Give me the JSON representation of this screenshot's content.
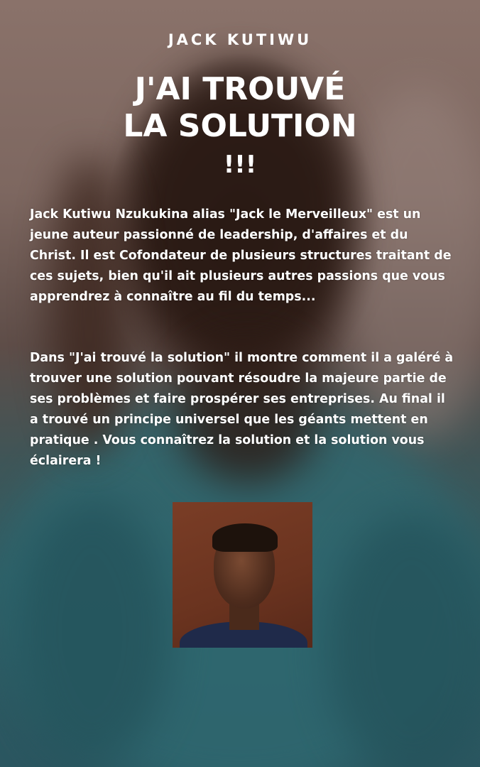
{
  "cover": {
    "author": "JACK KUTIWU",
    "title_line1": "J'AI TROUVÉ",
    "title_line2": "LA SOLUTION",
    "title_line3": "!!!",
    "paragraph1": "Jack Kutiwu Nzukukina alias \"Jack le Merveilleux\" est un jeune auteur passionné de leadership, d'affaires et du Christ. Il est Cofondateur de plusieurs structures traitant de ces sujets, bien qu'il ait plusieurs autres passions que vous apprendrez à connaître au fil du temps...",
    "paragraph2": "Dans \"J'ai trouvé la solution\" il montre comment il a galéré à trouver une solution pouvant résoudre la majeure partie de ses problèmes et faire prospérer ses entreprises. Au final il a trouvé un principe universel que les géants mettent en pratique . Vous connaîtrez la solution et la solution vous éclairera !"
  }
}
